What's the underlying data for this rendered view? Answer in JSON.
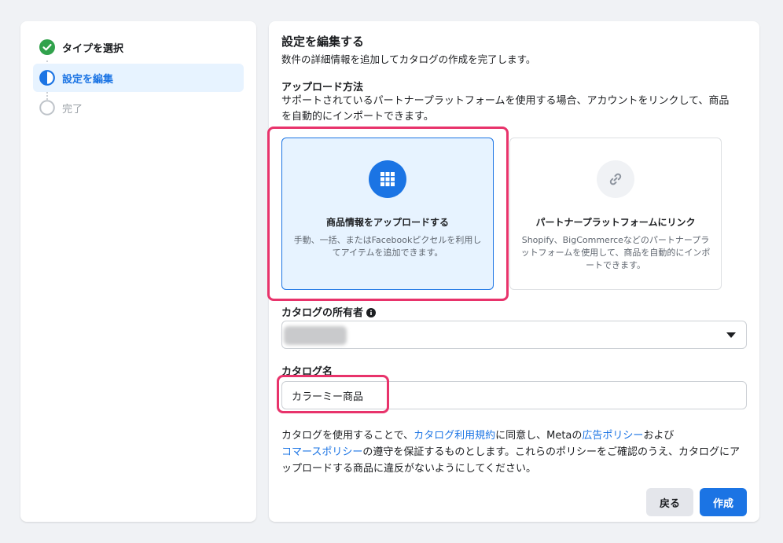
{
  "stepper": {
    "steps": [
      {
        "label": "タイプを選択",
        "state": "complete"
      },
      {
        "label": "設定を編集",
        "state": "active"
      },
      {
        "label": "完了",
        "state": "pending"
      }
    ]
  },
  "form": {
    "title": "設定を編集する",
    "subtitle": "数件の詳細情報を追加してカタログの作成を完了します。",
    "upload_method": {
      "label": "アップロード方法",
      "description": "サポートされているパートナープラットフォームを使用する場合、アカウントをリンクして、商品を自動的にインポートできます。",
      "options": [
        {
          "title": "商品情報をアップロードする",
          "description": "手動、一括、またはFacebookピクセルを利用してアイテムを追加できます。",
          "selected": true,
          "icon": "grid-icon"
        },
        {
          "title": "パートナープラットフォームにリンク",
          "description": "Shopify、BigCommerceなどのパートナープラットフォームを使用して、商品を自動的にインポートできます。",
          "selected": false,
          "icon": "link-icon"
        }
      ]
    },
    "owner": {
      "label": "カタログの所有者"
    },
    "catalog_name": {
      "label": "カタログ名",
      "value": "カラーミー商品"
    },
    "legal": {
      "t1": "カタログを使用することで、",
      "link_terms": "カタログ利用規約",
      "t2": "に同意し、Metaの",
      "link_ad_policy": "広告ポリシー",
      "t3": "および",
      "link_commerce_policy": "コマースポリシー",
      "t4": "の遵守を保証するものとします。これらのポリシーをご確認のうえ、カタログにアップロードする商品に違反がないようにしてください。"
    },
    "buttons": {
      "back": "戻る",
      "create": "作成"
    }
  },
  "colors": {
    "accent": "#1b74e4",
    "highlight": "#e8336b",
    "success": "#31a24c"
  }
}
